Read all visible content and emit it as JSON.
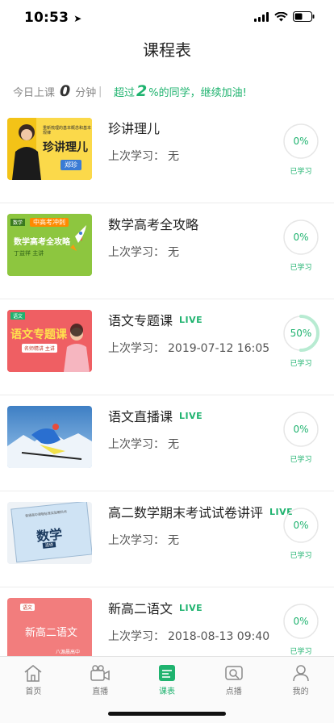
{
  "status": {
    "time": "10:53"
  },
  "header": {
    "title": "课程表"
  },
  "summary": {
    "today_prefix": "今日上课",
    "minutes": "0",
    "minutes_unit": "分钟",
    "divider": "|",
    "beat_prefix": "超过",
    "beat_value": "2",
    "beat_suffix": "%的同学，继续加油!"
  },
  "courses": [
    {
      "title": "珍讲理儿",
      "live": "",
      "last_label": "上次学习：",
      "last_value": "无",
      "progress_text": "0%",
      "progress": 0,
      "learned_label": "已学习",
      "thumb_texts": [
        "重新梳理的基本概念和基本规律",
        "珍讲理儿",
        "郑珍"
      ]
    },
    {
      "title": "数学高考全攻略",
      "live": "",
      "last_label": "上次学习：",
      "last_value": "无",
      "progress_text": "0%",
      "progress": 0,
      "learned_label": "已学习",
      "thumb_texts": [
        "数学",
        "中高考冲刺",
        "数学高考全攻略",
        "丁益祥 主讲"
      ]
    },
    {
      "title": "语文专题课",
      "live": "LIVE",
      "last_label": "上次学习：",
      "last_value": "2019-07-12  16:05",
      "progress_text": "50%",
      "progress": 0.5,
      "learned_label": "已学习",
      "thumb_texts": [
        "语文",
        "语文专题课",
        "名师精讲 主讲"
      ]
    },
    {
      "title": "语文直播课",
      "live": "LIVE",
      "last_label": "上次学习：",
      "last_value": "无",
      "progress_text": "0%",
      "progress": 0,
      "learned_label": "已学习",
      "thumb_texts": []
    },
    {
      "title": "高二数学期末考试试卷讲评",
      "live": "LIVE",
      "last_label": "上次学习：",
      "last_value": "无",
      "progress_text": "0%",
      "progress": 0,
      "learned_label": "已学习",
      "thumb_texts": [
        "普通高中课程标准实验教科书",
        "数学",
        "选修"
      ]
    },
    {
      "title": "新高二语文",
      "live": "LIVE",
      "last_label": "上次学习：",
      "last_value": "2018-08-13  09:40",
      "progress_text": "0%",
      "progress": 0,
      "learned_label": "已学习",
      "thumb_texts": [
        "语文",
        "新高二语文",
        "八源晨高中"
      ]
    }
  ],
  "tabs": [
    {
      "label": "首页",
      "icon": "home-icon",
      "active": false
    },
    {
      "label": "直播",
      "icon": "camera-icon",
      "active": false
    },
    {
      "label": "课表",
      "icon": "schedule-icon",
      "active": true
    },
    {
      "label": "点播",
      "icon": "video-icon",
      "active": false
    },
    {
      "label": "我的",
      "icon": "person-icon",
      "active": false
    }
  ],
  "colors": {
    "accent": "#1fb36f",
    "ring": "#e6e6e6"
  }
}
